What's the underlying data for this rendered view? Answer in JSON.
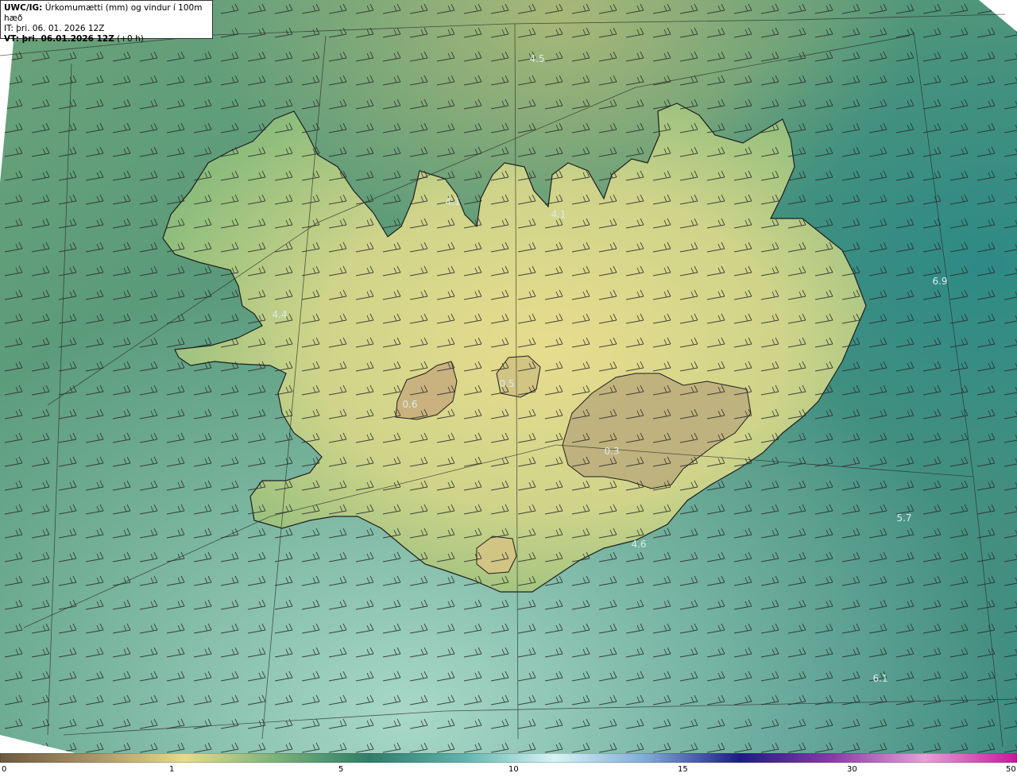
{
  "header": {
    "product_bold": "UWC/IG:",
    "product_desc": " Úrkomumætti (mm) og vindur í 100m hæð",
    "it_line": "IT: þri. 06. 01. 2026 12Z",
    "vt_bold": "VT: þri. 06.01.2026 12Z",
    "vt_suffix": " (+0 h)"
  },
  "map": {
    "point_labels": [
      {
        "name": "label-4-5",
        "text": "4.5"
      },
      {
        "name": "label-4-1-a",
        "text": "4.1"
      },
      {
        "name": "label-4-1-b",
        "text": "4.1"
      },
      {
        "name": "label-4-4",
        "text": "4.4"
      },
      {
        "name": "label-6-9",
        "text": "6.9"
      },
      {
        "name": "label-0-5",
        "text": "0.5"
      },
      {
        "name": "label-0-6",
        "text": "0.6"
      },
      {
        "name": "label-0-3",
        "text": "0.3"
      },
      {
        "name": "label-5-7",
        "text": "5.7"
      },
      {
        "name": "label-4-6",
        "text": "4.6"
      },
      {
        "name": "label-6-1",
        "text": "6.1"
      }
    ],
    "label_color": "#d8ecec"
  },
  "colorbar": {
    "ticks": [
      "0",
      "1",
      "5",
      "10",
      "15",
      "30",
      "50"
    ],
    "colors": [
      "#6b5a3e",
      "#a89466",
      "#e6dc8c",
      "#7ab07a",
      "#2f7d69",
      "#5fb3ad",
      "#d8f4f4",
      "#7fa9d6",
      "#1c1c86",
      "#8a3aa8",
      "#e6a0d6",
      "#c8189a"
    ]
  }
}
